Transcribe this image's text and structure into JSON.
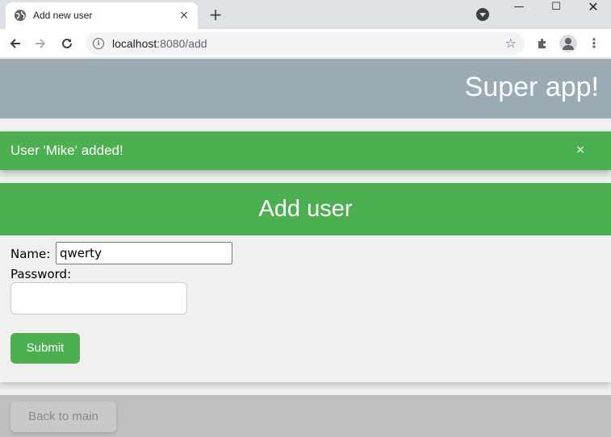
{
  "browser": {
    "tab_title": "Add new user",
    "tab_close": "×",
    "new_tab": "+",
    "url_host": "localhost",
    "url_path": ":8080/add",
    "window_min": "—",
    "window_max": "☐",
    "window_close": "✕"
  },
  "app": {
    "title": "Super app!"
  },
  "alert": {
    "message": "User 'Mike' added!",
    "close": "×",
    "color": "#4caf50"
  },
  "form": {
    "title": "Add user",
    "name_label": "Name:",
    "name_value": "qwerty",
    "password_label": "Password:",
    "submit_label": "Submit"
  },
  "footer": {
    "back_label": "Back to main"
  }
}
